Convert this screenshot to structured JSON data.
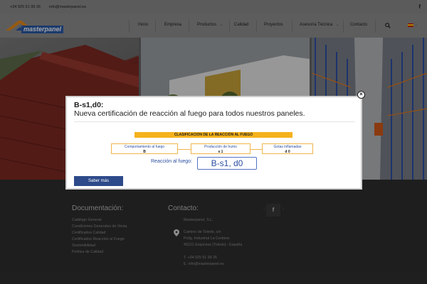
{
  "topbar": {
    "phone": "+34 925 51 99 26",
    "email": "info@masterpanel.es",
    "social_icon": "facebook-icon"
  },
  "header": {
    "logo_text": "masterpanel",
    "nav": [
      {
        "label": "Inicio",
        "has_dropdown": false
      },
      {
        "label": "Empresa",
        "has_dropdown": false
      },
      {
        "label": "Productos",
        "has_dropdown": true
      },
      {
        "label": "Calidad",
        "has_dropdown": false
      },
      {
        "label": "Proyectos",
        "has_dropdown": false
      },
      {
        "label": "Asesoría Técnica",
        "has_dropdown": true
      },
      {
        "label": "Contacto",
        "has_dropdown": false
      }
    ],
    "search_icon": "search-icon",
    "language_icon": "spain-flag-icon",
    "dropdown_glyph": "⌄"
  },
  "modal": {
    "title": "B-s1,d0:",
    "subtitle": "Nueva certificación de reacción al fuego para todos nuestros paneles.",
    "close_glyph": "×",
    "certificate": {
      "header": "CLASIFICACION DE LA REACCIÓN AL FUEGO",
      "boxes": [
        {
          "label": "Comportamiento al fuego",
          "value": "B"
        },
        {
          "label": "Producción de humo",
          "value": "s     1"
        },
        {
          "label": "Gotas inflamadas",
          "value": "d     0"
        }
      ],
      "reaction_label": "Reacción al fuego:",
      "reaction_value": "B-s1, d0"
    },
    "button_label": "Saber más"
  },
  "footer": {
    "documentation": {
      "title": "Documentación:",
      "links": [
        "Catálogo General",
        "Condiciones Generales de Venta",
        "Certificados Calidad",
        "Certificados Reacción al Fuego",
        "Sostenibilidad",
        "Política de Calidad"
      ]
    },
    "contact": {
      "title": "Contacto:",
      "company": "Masterpanel, S.L.",
      "address": [
        "Camino de Toledo, s/n",
        "Polig. Industrial La Cerbera",
        "45221 Esquivias (Toledo) - España"
      ],
      "phone": "T. +34 925 51 99 26",
      "email": "E. info@masterpanel.es"
    },
    "social_icon": "facebook-icon",
    "carousel_prev": "‹",
    "carousel_next": "›"
  },
  "colors": {
    "brand_blue": "#2d4a8a",
    "certificate_orange": "#f5b21c",
    "footer_bg": "#2f2f2f"
  }
}
